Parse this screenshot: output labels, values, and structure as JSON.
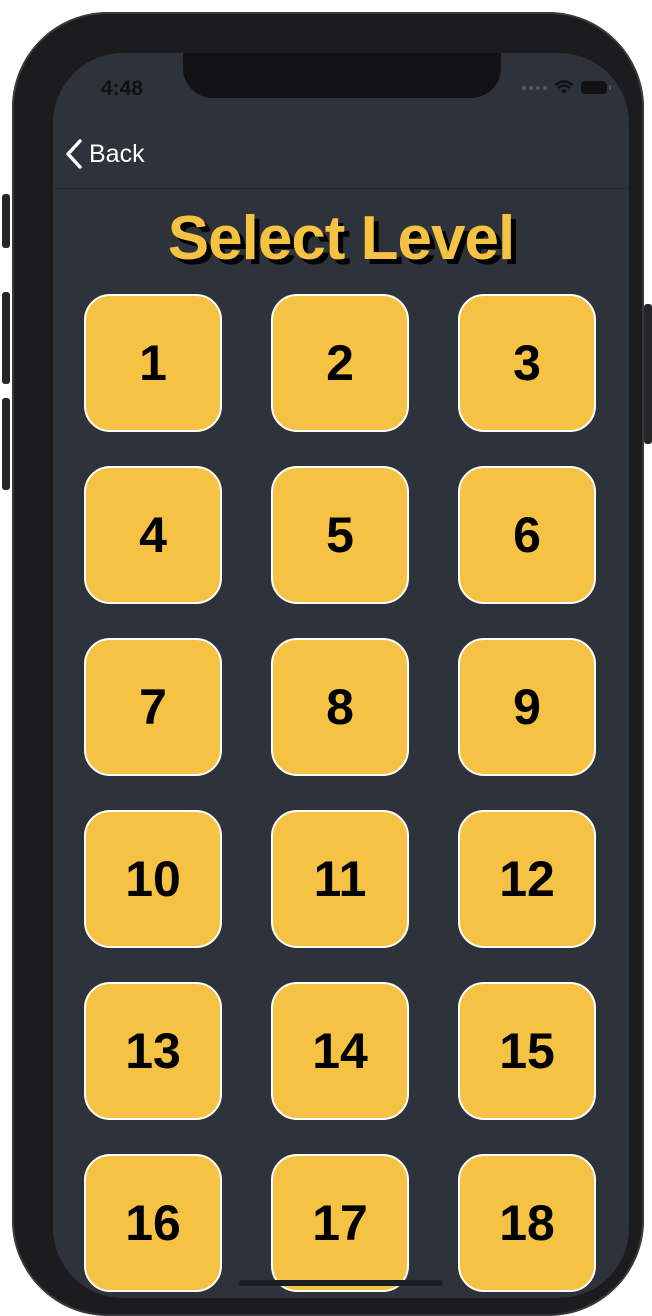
{
  "status_bar": {
    "time": "4:48"
  },
  "navbar": {
    "back_label": "Back"
  },
  "title": "Select Level",
  "levels": [
    "1",
    "2",
    "3",
    "4",
    "5",
    "6",
    "7",
    "8",
    "9",
    "10",
    "11",
    "12",
    "13",
    "14",
    "15",
    "16",
    "17",
    "18"
  ],
  "colors": {
    "background": "#2e323b",
    "accent": "#f5c243",
    "tile_border": "#ffffff",
    "tile_text": "#000000"
  },
  "icons": {
    "back": "chevron-left-icon",
    "wifi": "wifi-icon",
    "battery": "battery-icon",
    "signal": "signal-icon"
  }
}
